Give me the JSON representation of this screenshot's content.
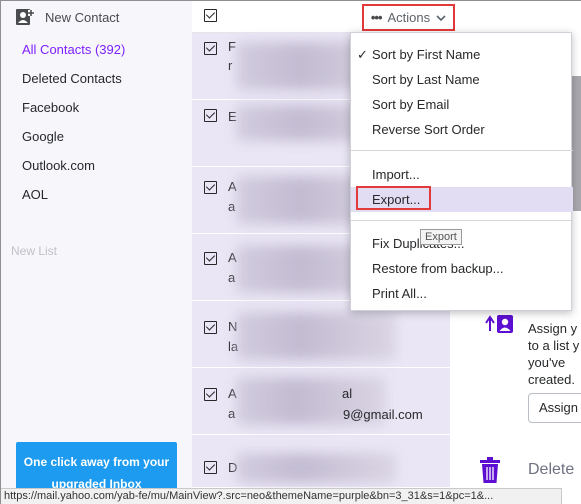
{
  "sidebar": {
    "new_contact_label": "New Contact",
    "items": [
      {
        "label": "All Contacts (392)"
      },
      {
        "label": "Deleted Contacts"
      },
      {
        "label": "Facebook"
      },
      {
        "label": "Google"
      },
      {
        "label": "Outlook.com"
      },
      {
        "label": "AOL"
      }
    ],
    "new_list_placeholder": "New List",
    "promo_line1": "One click away from your",
    "promo_line2": "upgraded Inbox"
  },
  "list": {
    "rows": [
      {
        "initial": "F",
        "line2": "r"
      },
      {
        "initial": "E",
        "line2": ""
      },
      {
        "initial": "A",
        "line2": "a"
      },
      {
        "initial": "A",
        "line2": "a"
      },
      {
        "initial": "N",
        "line2": "la"
      },
      {
        "initial": "A",
        "line2": "a",
        "extra_top": "al",
        "extra_bottom": "9@gmail.com"
      },
      {
        "initial": "D",
        "line2": ""
      }
    ]
  },
  "actions": {
    "label": "Actions",
    "menu": {
      "sort_first": "Sort by First Name",
      "sort_last": "Sort by Last Name",
      "sort_email": "Sort by Email",
      "reverse": "Reverse Sort Order",
      "import": "Import...",
      "export": "Export...",
      "fix_duplicates": "Fix Duplicates...",
      "restore": "Restore from backup...",
      "print": "Print All..."
    },
    "tooltip": "Export"
  },
  "pane": {
    "assign_text_lines": [
      "Assign y",
      "to a list y",
      "you've",
      "created."
    ],
    "assign_button": "Assign",
    "delete_label": "Delete"
  },
  "status_bar": {
    "url": "https://mail.yahoo.com/yab-fe/mu/MainView?.src=neo&themeName=purple&bn=3_31&s=1&pc=1&..."
  },
  "colors": {
    "accent": "#7e1fff",
    "highlight_box": "#e2393a",
    "promo": "#1d9bf0",
    "list_bg": "#eae6f5"
  }
}
